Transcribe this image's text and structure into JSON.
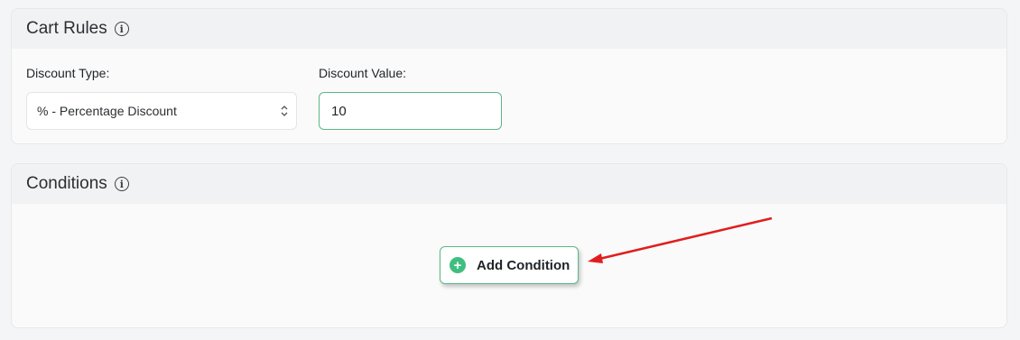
{
  "cart_rules": {
    "title": "Cart Rules",
    "info_icon": "info-icon",
    "discount_type_label": "Discount Type:",
    "discount_type_value": "% - Percentage Discount",
    "discount_value_label": "Discount Value:",
    "discount_value": "10"
  },
  "conditions": {
    "title": "Conditions",
    "info_icon": "info-icon",
    "add_button_label": "Add Condition",
    "add_button_icon": "plus-circle-icon"
  },
  "annotation": {
    "arrow_color": "#e01e1e"
  },
  "colors": {
    "accent_green": "#3fbf7f",
    "input_border_green": "#58b886"
  }
}
